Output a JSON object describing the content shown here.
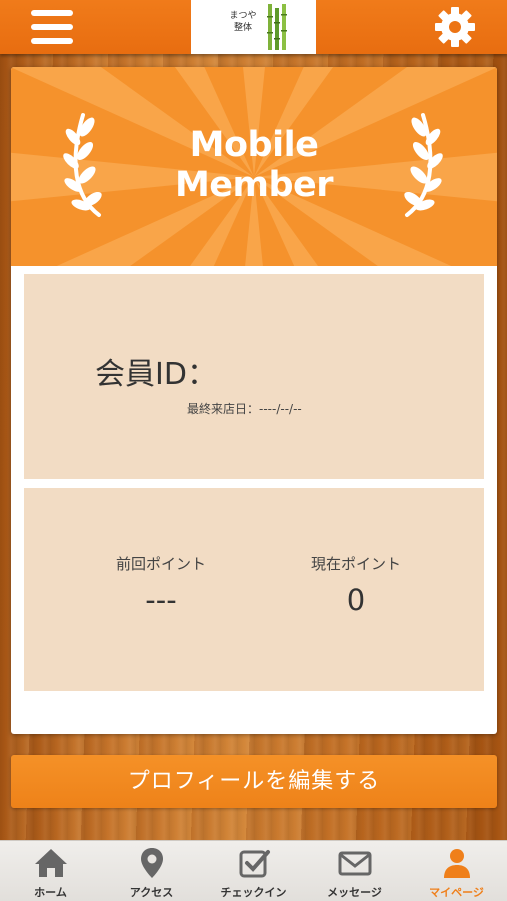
{
  "header": {
    "logo_text": "まつや\n整体",
    "menu_icon": "hamburger-menu-icon",
    "settings_icon": "gear-icon"
  },
  "banner": {
    "title_line1": "Mobile",
    "title_line2": "Member"
  },
  "member": {
    "id_label": "会員ID：",
    "last_visit": "最終来店日：----/--/--"
  },
  "points": {
    "previous_label": "前回ポイント",
    "previous_value": "---",
    "current_label": "現在ポイント",
    "current_value": "0"
  },
  "edit_button_label": "プロフィールを編集する",
  "tabs": [
    {
      "label": "ホーム",
      "icon": "home-icon",
      "active": false
    },
    {
      "label": "アクセス",
      "icon": "map-pin-icon",
      "active": false
    },
    {
      "label": "チェックイン",
      "icon": "checkbox-icon",
      "active": false
    },
    {
      "label": "メッセージ",
      "icon": "envelope-icon",
      "active": false
    },
    {
      "label": "マイページ",
      "icon": "person-icon",
      "active": true
    }
  ],
  "colors": {
    "accent": "#ef7f1a",
    "panel": "#f2dcc4",
    "banner": "#f5922c"
  }
}
